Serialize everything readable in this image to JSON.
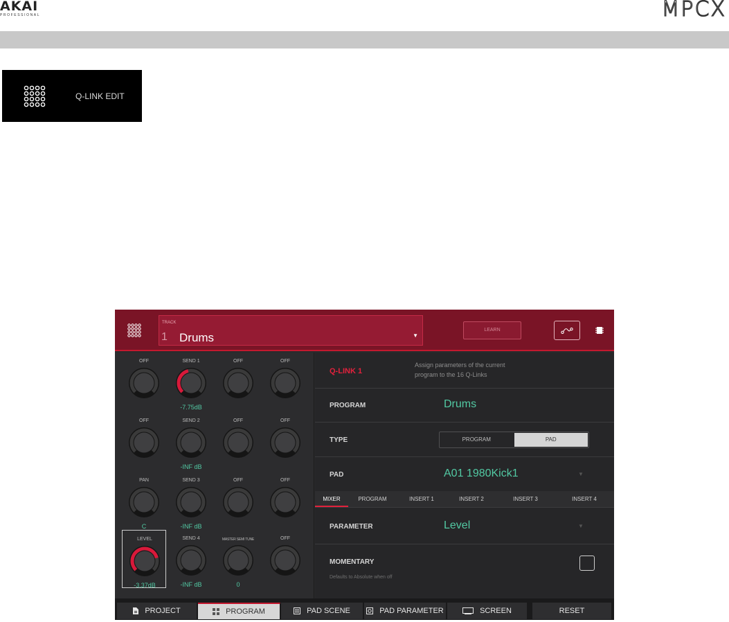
{
  "page": {
    "brand_left": "AKAI",
    "brand_left_sub": "PROFESSIONAL",
    "brand_right": "MPCX",
    "header_label": "Q-LINK EDIT"
  },
  "topbar": {
    "track_label": "TRACK",
    "track_number": "1",
    "track_name": "Drums",
    "learn_label": "LEARN",
    "icons": [
      "grid-icon",
      "curve-icon",
      "chip-icon"
    ]
  },
  "knobs": [
    {
      "label": "OFF",
      "value": "",
      "level": 0
    },
    {
      "label": "SEND 1",
      "value": "-7.75dB",
      "level": 0.45
    },
    {
      "label": "OFF",
      "value": "",
      "level": 0
    },
    {
      "label": "OFF",
      "value": "",
      "level": 0
    },
    {
      "label": "OFF",
      "value": "",
      "level": 0
    },
    {
      "label": "SEND 2",
      "value": "-INF dB",
      "level": 0
    },
    {
      "label": "OFF",
      "value": "",
      "level": 0
    },
    {
      "label": "OFF",
      "value": "",
      "level": 0
    },
    {
      "label": "PAN",
      "value": "C",
      "level": 0
    },
    {
      "label": "SEND 3",
      "value": "-INF dB",
      "level": 0
    },
    {
      "label": "OFF",
      "value": "",
      "level": 0
    },
    {
      "label": "OFF",
      "value": "",
      "level": 0
    },
    {
      "label": "LEVEL",
      "value": "-3.37dB",
      "level": 0.78
    },
    {
      "label": "SEND 4",
      "value": "-INF dB",
      "level": 0
    },
    {
      "label": "MASTER SEMI TUNE",
      "value": "0",
      "level": 0
    },
    {
      "label": "OFF",
      "value": "",
      "level": 0
    }
  ],
  "qlink": {
    "title": "Q-LINK 1",
    "desc_line1": "Assign parameters of the current",
    "desc_line2": "program to the 16 Q-Links"
  },
  "program": {
    "label": "PROGRAM",
    "value": "Drums"
  },
  "type": {
    "label": "TYPE",
    "options": [
      "PROGRAM",
      "PAD"
    ],
    "selected": "PAD"
  },
  "pad": {
    "label": "PAD",
    "value": "A01 1980Kick1"
  },
  "tabs": [
    "MIXER",
    "PROGRAM",
    "INSERT 1",
    "INSERT 2",
    "INSERT 3",
    "INSERT 4"
  ],
  "parameter": {
    "label": "PARAMETER",
    "value": "Level"
  },
  "momentary": {
    "label": "MOMENTARY",
    "sub": "Defaults to Absolute when off",
    "checked": false
  },
  "bottom": {
    "project": "PROJECT",
    "program": "PROGRAM",
    "pad_scene": "PAD SCENE",
    "pad_parameter": "PAD PARAMETER",
    "screen": "SCREEN",
    "reset": "RESET"
  },
  "colors": {
    "accent": "#e3213c",
    "value_green": "#52c9a3",
    "topbar": "#7a1426"
  }
}
